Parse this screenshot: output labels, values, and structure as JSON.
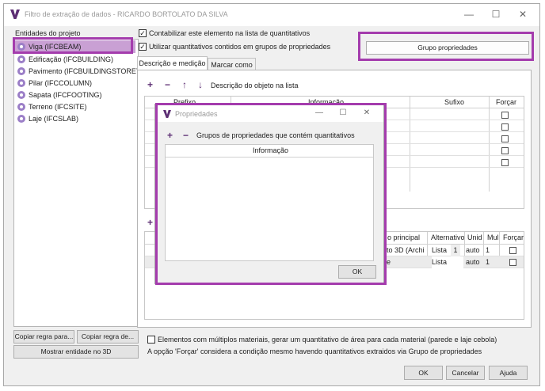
{
  "window": {
    "title": "Filtro de extração de dados - RICARDO BORTOLATO DA SILVA"
  },
  "window_controls": {
    "minimize": "—",
    "maximize": "☐",
    "close": "✕"
  },
  "colors": {
    "highlight": "#a43cad",
    "selected_bg": "#c9a0d4",
    "brand": "#5d2f74"
  },
  "left": {
    "title": "Entidades do projeto",
    "items": [
      "Viga (IFCBEAM)",
      "Edificação (IFCBUILDING)",
      "Pavimento (IFCBUILDINGSTOREY)",
      "Pilar (IFCCOLUMN)",
      "Sapata (IFCFOOTING)",
      "Terreno (IFCSITE)",
      "Laje (IFCSLAB)"
    ],
    "copy_rule_to": "Copiar regra para...",
    "copy_rule_from": "Copiar regra de...",
    "show_3d": "Mostrar entidade no 3D"
  },
  "options": {
    "count_element": "Contabilizar este elemento na lista de quantitativos",
    "use_property_groups": "Utilizar quantitativos contidos em grupos de propriedades",
    "property_group_button": "Grupo propriedades"
  },
  "tabs": [
    "Descrição e medição",
    "Marcar como"
  ],
  "description": {
    "toolbar_label": "Descrição do objeto na lista",
    "columns": [
      "Prefixo",
      "Informação",
      "Sufixo",
      "Forçar"
    ]
  },
  "measure": {
    "columns": [
      "o principal",
      "Alternativo",
      "Unid",
      "Mul",
      "Forçar"
    ],
    "rows": [
      {
        "info": "nto 3D (Archi",
        "alt": "Lista",
        "num": "1",
        "unit": "auto",
        "mul": "1"
      },
      {
        "info": "ne",
        "alt": "Lista",
        "num": "",
        "unit": "auto",
        "mul": "1"
      }
    ]
  },
  "footer": {
    "multi_material": "Elementos com múltiplos materiais, gerar um quantitativo de área para cada material (parede e laje cebola)",
    "note": "A opção 'Forçar' considera a condição mesmo havendo quantitativos extraidos via Grupo de propriedades",
    "ok": "OK",
    "cancel": "Cancelar",
    "help": "Ajuda"
  },
  "dialog": {
    "title": "Propriedades",
    "toolbar_label": "Grupos de propriedades que contém quantitativos",
    "column": "Informação",
    "ok": "OK"
  },
  "icons": {
    "add": "+",
    "remove": "−",
    "up": "↑",
    "down": "↓"
  }
}
